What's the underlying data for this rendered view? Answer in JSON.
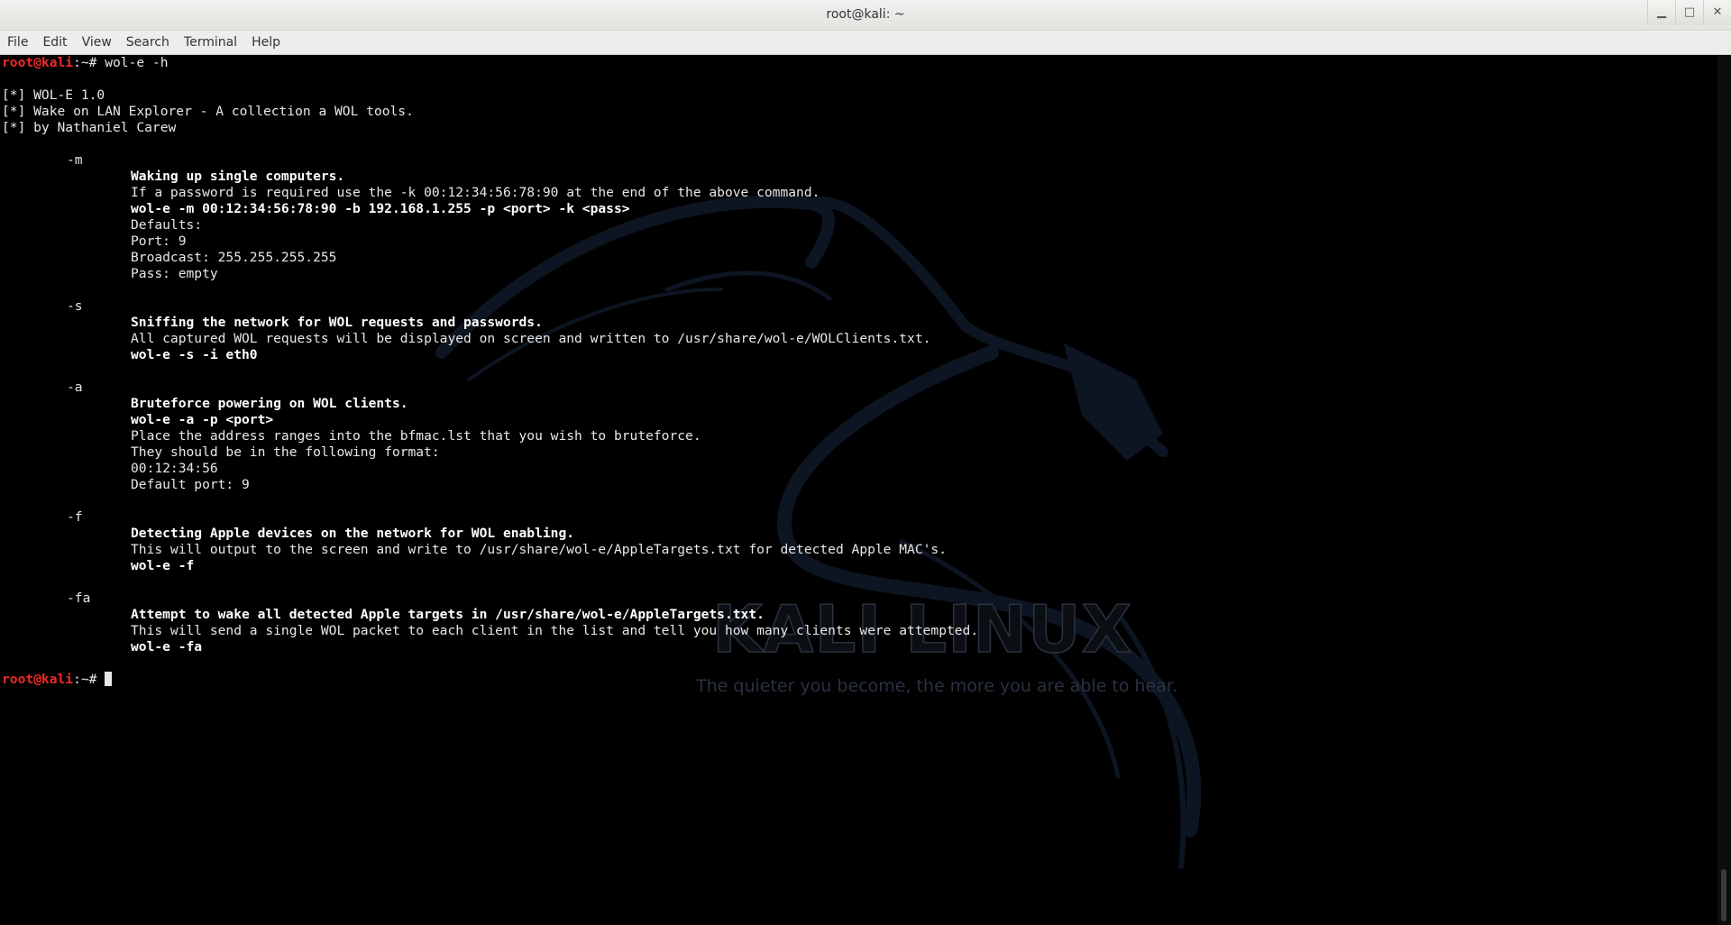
{
  "window": {
    "title": "root@kali: ~",
    "controls": [
      "minimize-icon",
      "maximize-icon",
      "close-icon"
    ]
  },
  "menubar": {
    "items": [
      "File",
      "Edit",
      "View",
      "Search",
      "Terminal",
      "Help"
    ]
  },
  "terminal": {
    "prompt_user": "root@kali",
    "prompt_suffix": ":~# ",
    "command": "wol-e -h",
    "header": [
      "[*] WOL-E 1.0",
      "[*] Wake on LAN Explorer - A collection a WOL tools.",
      "[*] by Nathaniel Carew"
    ],
    "sections": [
      {
        "flag": "-m",
        "title": "Waking up single computers.",
        "lines": [
          {
            "text": "If a password is required use the -k 00:12:34:56:78:90 at the end of the above command.",
            "bold": false
          },
          {
            "text": "wol-e -m 00:12:34:56:78:90 -b 192.168.1.255 -p <port> -k <pass>",
            "bold": true
          },
          {
            "text": "Defaults:",
            "bold": false
          },
          {
            "text": "Port: 9",
            "bold": false
          },
          {
            "text": "Broadcast: 255.255.255.255",
            "bold": false
          },
          {
            "text": "Pass: empty",
            "bold": false
          }
        ]
      },
      {
        "flag": "-s",
        "title": "Sniffing the network for WOL requests and passwords.",
        "lines": [
          {
            "text": "All captured WOL requests will be displayed on screen and written to /usr/share/wol-e/WOLClients.txt.",
            "bold": false
          },
          {
            "text": "wol-e -s -i eth0",
            "bold": true
          }
        ]
      },
      {
        "flag": "-a",
        "title": "Bruteforce powering on WOL clients.",
        "lines": [
          {
            "text": "wol-e -a -p <port>",
            "bold": true
          },
          {
            "text": "Place the address ranges into the bfmac.lst that you wish to bruteforce.",
            "bold": false
          },
          {
            "text": "They should be in the following format:",
            "bold": false
          },
          {
            "text": "00:12:34:56",
            "bold": false
          },
          {
            "text": "Default port: 9",
            "bold": false
          }
        ]
      },
      {
        "flag": "-f",
        "title": "Detecting Apple devices on the network for WOL enabling.",
        "lines": [
          {
            "text": "This will output to the screen and write to /usr/share/wol-e/AppleTargets.txt for detected Apple MAC's.",
            "bold": false
          },
          {
            "text": "wol-e -f",
            "bold": true
          }
        ]
      },
      {
        "flag": "-fa",
        "title": "Attempt to wake all detected Apple targets in /usr/share/wol-e/AppleTargets.txt.",
        "lines": [
          {
            "text": "This will send a single WOL packet to each client in the list and tell you how many clients were attempted.",
            "bold": false
          },
          {
            "text": "wol-e -fa",
            "bold": true
          }
        ]
      }
    ]
  },
  "wallpaper": {
    "title": "KALI LINUX",
    "tagline": "The quieter you become, the more you are able to hear."
  },
  "colors": {
    "prompt": "#ef2929",
    "text": "#e8e8e8",
    "background": "#000000"
  }
}
